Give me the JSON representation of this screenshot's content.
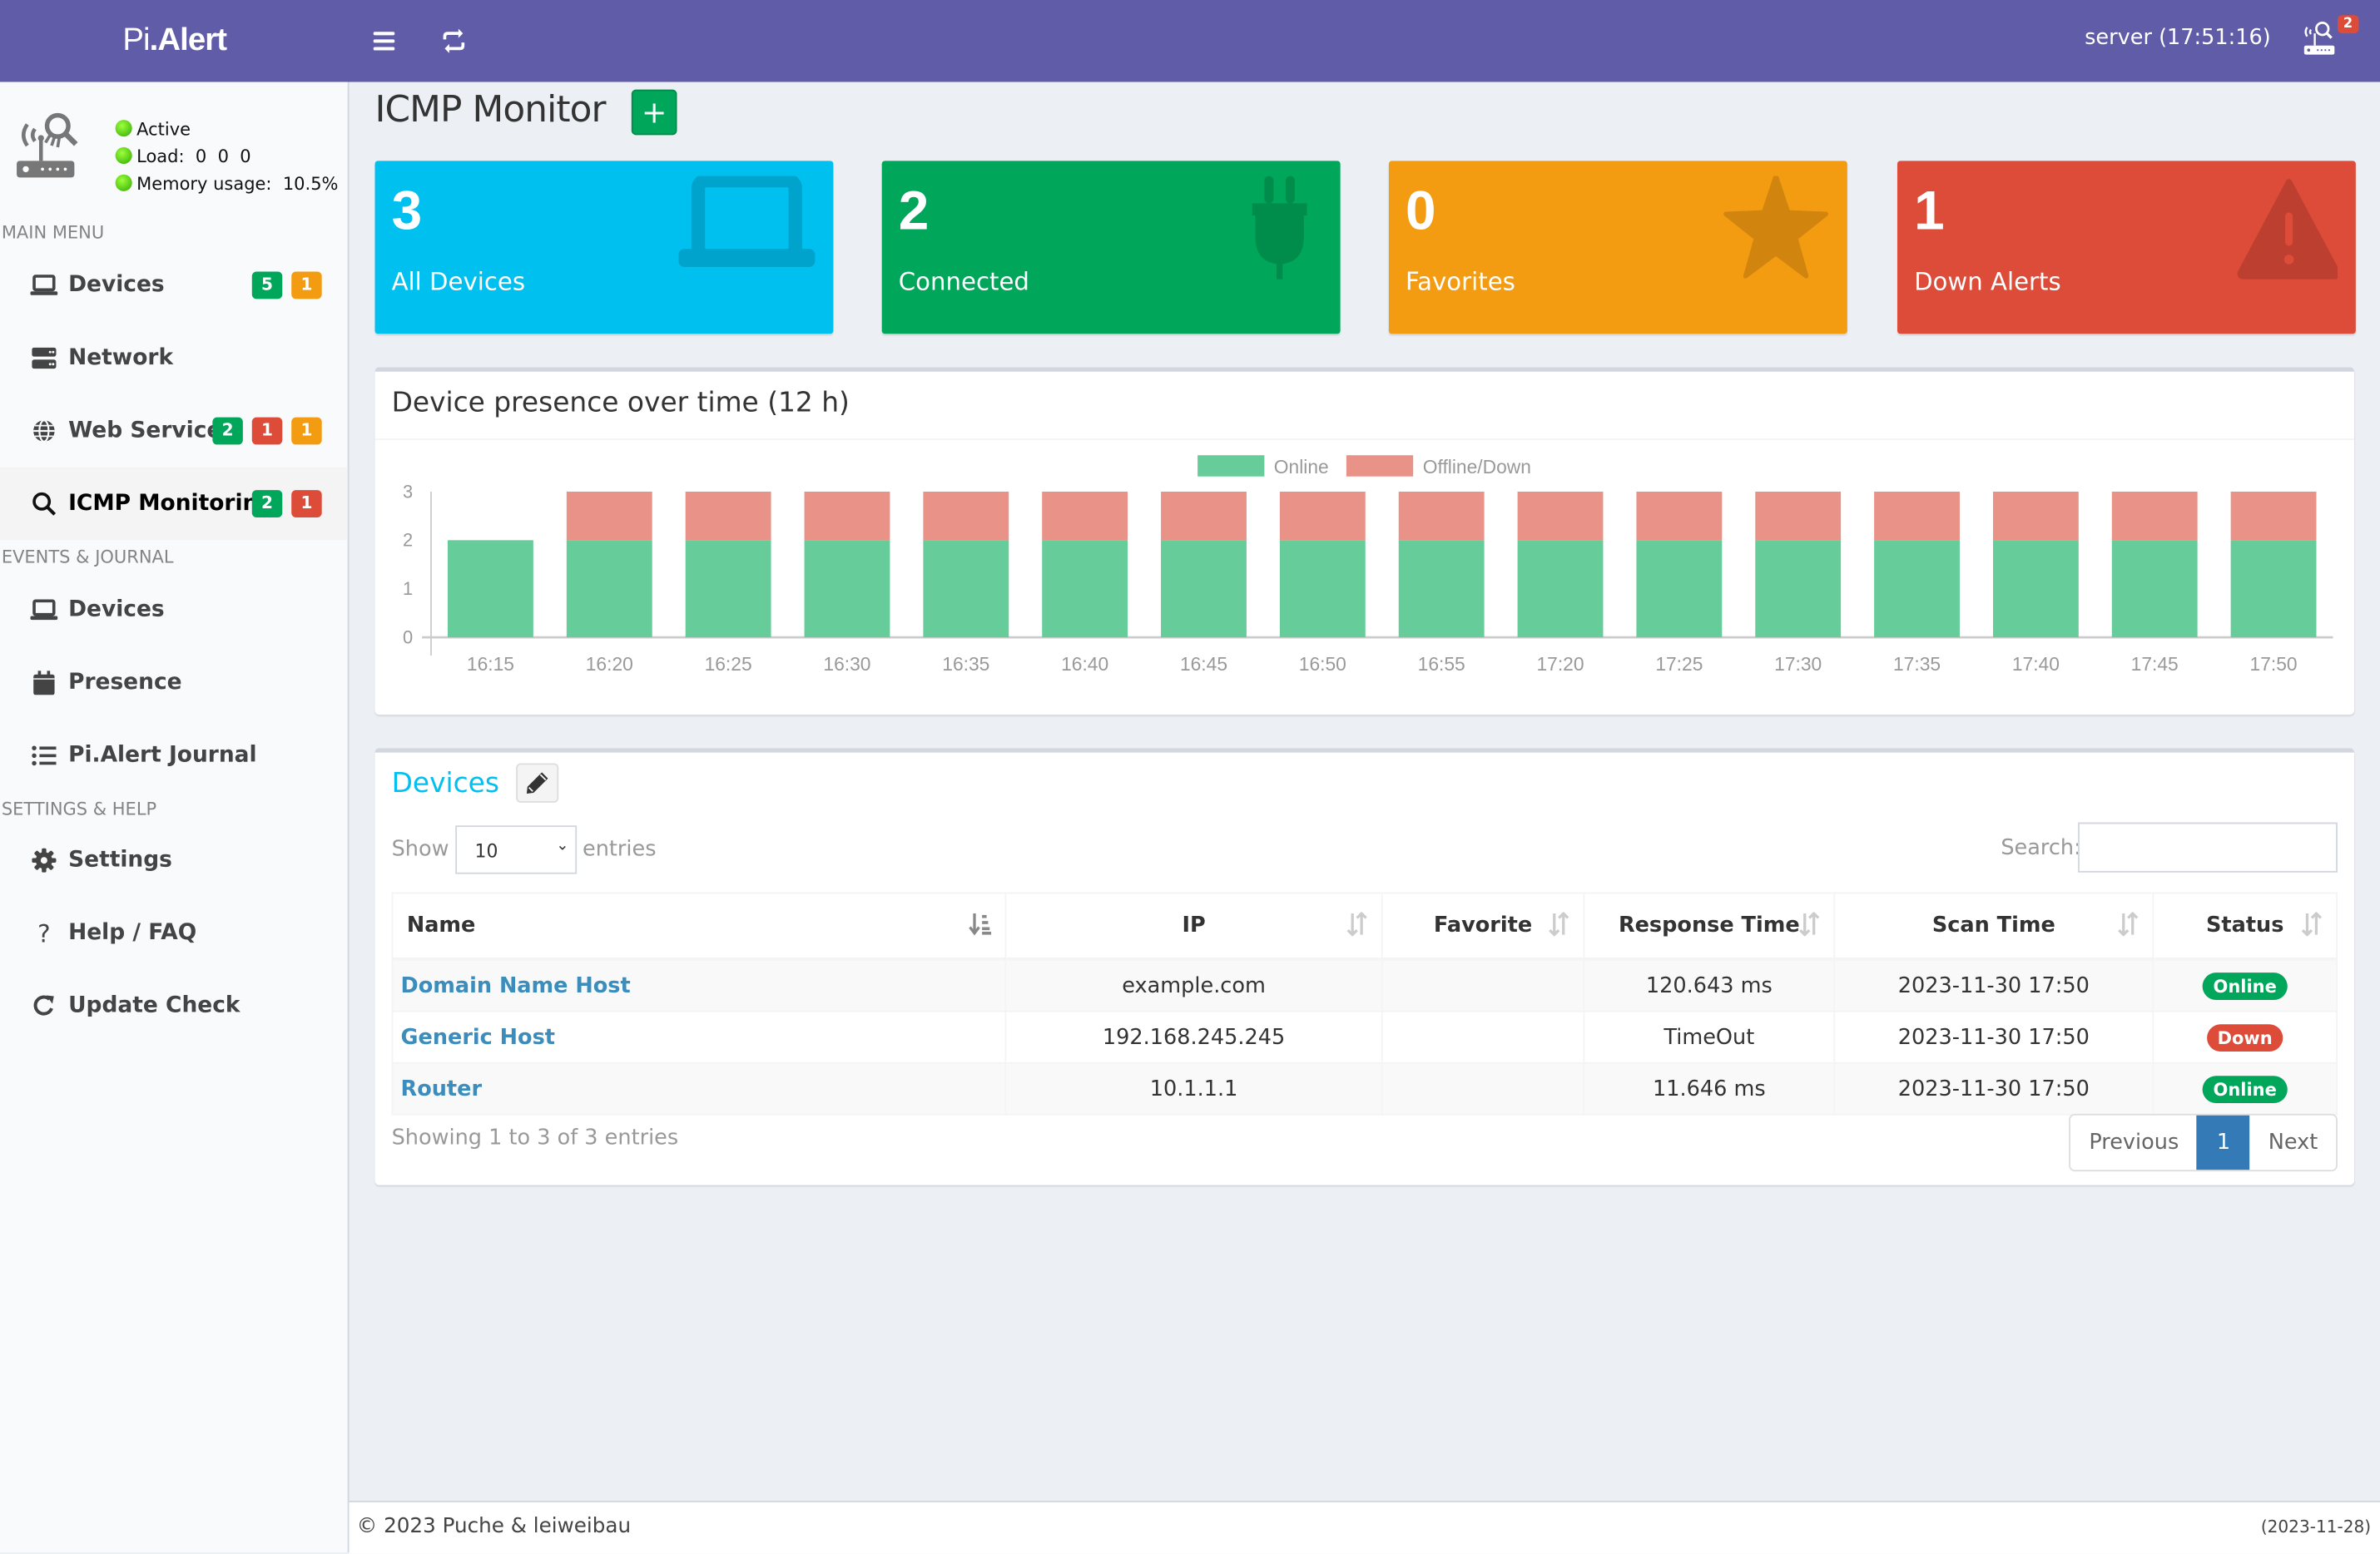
{
  "header": {
    "logo_light": "Pi",
    "logo_bold": ".Alert",
    "server_label": "server (17:51:16)",
    "notification_count": "2"
  },
  "sidebar": {
    "status": {
      "active": "Active",
      "load": "Load:  0  0  0",
      "memory": "Memory usage:  10.5%"
    },
    "sections": {
      "main": "MAIN MENU",
      "events": "EVENTS & JOURNAL",
      "settings": "SETTINGS & HELP"
    },
    "main_items": [
      {
        "label": "Devices",
        "icon": "laptop-icon",
        "badges": [
          "5",
          "1"
        ]
      },
      {
        "label": "Network",
        "icon": "server-icon",
        "badges": []
      },
      {
        "label": "Web Services",
        "icon": "globe-icon",
        "badges": [
          "2",
          "1",
          "1"
        ]
      },
      {
        "label": "ICMP Monitoring",
        "icon": "search-icon",
        "badges": [
          "2",
          "1"
        ],
        "active": true
      }
    ],
    "events_items": [
      {
        "label": "Devices",
        "icon": "laptop-icon"
      },
      {
        "label": "Presence",
        "icon": "calendar-icon"
      },
      {
        "label": "Pi.Alert Journal",
        "icon": "list-icon"
      }
    ],
    "settings_items": [
      {
        "label": "Settings",
        "icon": "gear-icon"
      },
      {
        "label": "Help / FAQ",
        "icon": "question-icon"
      },
      {
        "label": "Update Check",
        "icon": "refresh-icon"
      }
    ]
  },
  "page": {
    "title": "ICMP Monitor",
    "add_label": "+"
  },
  "stat_boxes": [
    {
      "value": "3",
      "label": "All Devices",
      "color": "#00c0ef",
      "icon": "laptop-icon"
    },
    {
      "value": "2",
      "label": "Connected",
      "color": "#00a65a",
      "icon": "plug-icon"
    },
    {
      "value": "0",
      "label": "Favorites",
      "color": "#f39c12",
      "icon": "star-icon"
    },
    {
      "value": "1",
      "label": "Down Alerts",
      "color": "#dd4b39",
      "icon": "warning-icon"
    }
  ],
  "chart_data": {
    "type": "bar",
    "stacked": true,
    "title": "Device presence over time (12 h)",
    "categories": [
      "16:15",
      "16:20",
      "16:25",
      "16:30",
      "16:35",
      "16:40",
      "16:45",
      "16:50",
      "16:55",
      "17:20",
      "17:25",
      "17:30",
      "17:35",
      "17:40",
      "17:45",
      "17:50"
    ],
    "series": [
      {
        "name": "Online",
        "color": "#66cc99",
        "values": [
          2,
          2,
          2,
          2,
          2,
          2,
          2,
          2,
          2,
          2,
          2,
          2,
          2,
          2,
          2,
          2
        ]
      },
      {
        "name": "Offline/Down",
        "color": "#e99287",
        "values": [
          0,
          1,
          1,
          1,
          1,
          1,
          1,
          1,
          1,
          1,
          1,
          1,
          1,
          1,
          1,
          1
        ]
      }
    ],
    "yticks": [
      "0",
      "1",
      "2",
      "3"
    ],
    "ylim": [
      0,
      3
    ],
    "xlabel": "",
    "ylabel": "",
    "legend": "top-center",
    "grid": false
  },
  "devices": {
    "title": "Devices",
    "show_label": "Show",
    "entries_label": "entries",
    "page_length": "10",
    "search_label": "Search:",
    "search_value": "",
    "columns": [
      "Name",
      "IP",
      "Favorite",
      "Response Time",
      "Scan Time",
      "Status"
    ],
    "rows": [
      {
        "name": "Domain Name Host",
        "ip": "example.com",
        "favorite": "",
        "response": "120.643 ms",
        "scan": "2023-11-30 17:50",
        "status": "Online",
        "status_color": "#00a65a"
      },
      {
        "name": "Generic Host",
        "ip": "192.168.245.245",
        "favorite": "",
        "response": "TimeOut",
        "scan": "2023-11-30 17:50",
        "status": "Down",
        "status_color": "#dd4b39"
      },
      {
        "name": "Router",
        "ip": "10.1.1.1",
        "favorite": "",
        "response": "11.646 ms",
        "scan": "2023-11-30 17:50",
        "status": "Online",
        "status_color": "#00a65a"
      }
    ],
    "info": "Showing 1 to 3 of 3 entries",
    "pagination": {
      "previous": "Previous",
      "current": "1",
      "next": "Next"
    }
  },
  "footer": {
    "copyright": "© 2023 Puche & leiweibau",
    "version": "(2023-11-28)"
  }
}
